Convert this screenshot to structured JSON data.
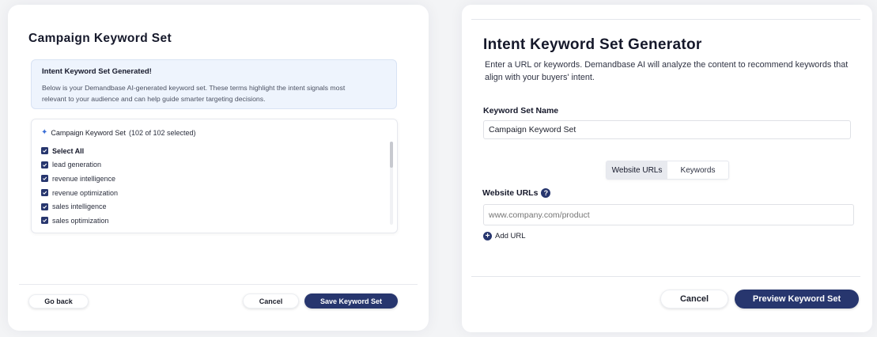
{
  "left": {
    "title": "Campaign Keyword Set",
    "notice": {
      "title": "Intent Keyword Set Generated!",
      "body_line1": "Below is your Demandbase AI-generated keyword set. These terms highlight the intent signals most",
      "body_line2": "relevant to your audience and can help guide smarter targeting decisions."
    },
    "keyword_set": {
      "name": "Campaign Keyword Set",
      "count": "(102 of 102 selected)",
      "select_all": "Select All",
      "items": [
        "lead generation",
        "revenue intelligence",
        "revenue optimization",
        "sales intelligence",
        "sales optimization"
      ]
    },
    "buttons": {
      "go_back": "Go back",
      "cancel": "Cancel",
      "save": "Save Keyword Set"
    }
  },
  "right": {
    "title": "Intent Keyword Set Generator",
    "description": "Enter a URL or keywords. Demandbase AI will analyze the content to recommend keywords that align with your buyers' intent.",
    "name_label": "Keyword Set Name",
    "name_value": "Campaign Keyword Set",
    "tabs": [
      "Website URLs",
      "Keywords"
    ],
    "urls_label": "Website URLs",
    "url_placeholder": "www.company.com/product",
    "add_url": "Add URL",
    "buttons": {
      "cancel": "Cancel",
      "preview": "Preview Keyword Set"
    }
  },
  "colors": {
    "primary": "#27366e",
    "notice_bg": "#eef4fd"
  },
  "icons": {
    "help": "question-circle-icon",
    "add": "plus-circle-icon",
    "checkbox": "checkbox-checked-icon",
    "sparkle": "sparkle-icon"
  }
}
